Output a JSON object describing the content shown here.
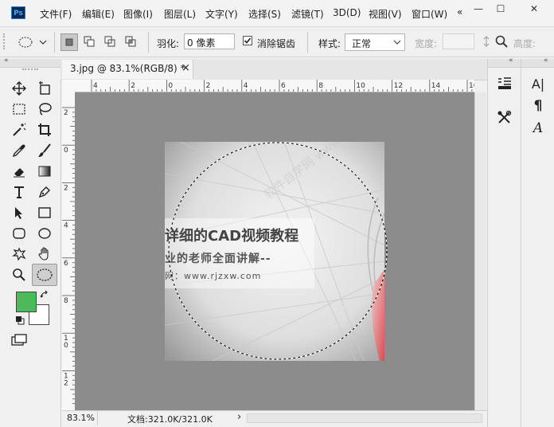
{
  "app": {
    "logo": "Ps"
  },
  "menu": {
    "items": [
      "文件(F)",
      "编辑(E)",
      "图像(I)",
      "图层(L)",
      "文字(Y)",
      "选择(S)",
      "滤镜(T)",
      "3D(D)",
      "视图(V)",
      "窗口(W)",
      "«"
    ]
  },
  "window_controls": {
    "minimize": "—",
    "restore": "☐",
    "close": "✕"
  },
  "options": {
    "feather_label": "羽化:",
    "feather_value": "0 像素",
    "antialias_label": "消除锯齿",
    "antialias_checked": true,
    "style_label": "样式:",
    "style_value": "正常",
    "width_label": "宽度:",
    "height_label": "高度:"
  },
  "document": {
    "tab_title": "3.jpg @ 83.1%(RGB/8) *",
    "close_glyph": "×"
  },
  "rulers": {
    "h_labels": [
      "4",
      "2",
      "0",
      "2",
      "4",
      "6",
      "8",
      "10",
      "12",
      "14",
      "16"
    ],
    "v_labels": [
      "2",
      "0",
      "2",
      "4",
      "6",
      "8",
      "1\n0",
      "1\n2"
    ]
  },
  "image_text": {
    "headline": "详细的CAD视频教程",
    "subline": "业的老师全面讲解--",
    "url": "网：www.rjzxw.com",
    "watermark": "软件自学网 www.rjzxw.com"
  },
  "status": {
    "zoom": "83.1%",
    "doc_info": "文档:321.0K/321.0K",
    "arrow": "›"
  },
  "colors": {
    "foreground": "#4cba5a",
    "background": "#ffffff",
    "canvas_bg": "#8c8c8c"
  },
  "panels": {
    "right_b_labels": [
      "A|",
      "¶",
      "A"
    ]
  }
}
